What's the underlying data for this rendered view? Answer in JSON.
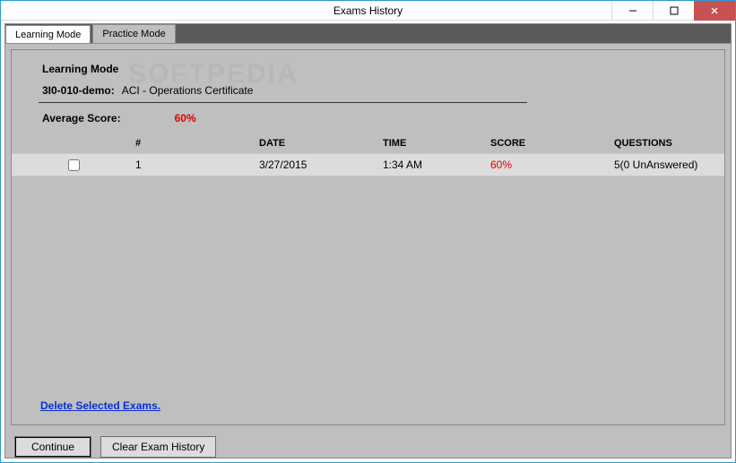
{
  "window": {
    "title": "Exams History"
  },
  "tabs": [
    {
      "label": "Learning Mode",
      "active": true
    },
    {
      "label": "Practice Mode",
      "active": false
    }
  ],
  "main": {
    "heading": "Learning Mode",
    "exam_code": "3I0-010-demo:",
    "exam_name": "ACI - Operations Certificate",
    "avg_label": "Average Score:",
    "avg_value": "60%",
    "watermark": "SOFTPEDIA"
  },
  "table": {
    "headers": {
      "num": "#",
      "date": "DATE",
      "time": "TIME",
      "score": "SCORE",
      "questions": "QUESTIONS"
    },
    "rows": [
      {
        "checked": false,
        "num": "1",
        "date": "3/27/2015",
        "time": "1:34 AM",
        "score": "60%",
        "questions": "5(0 UnAnswered)"
      }
    ]
  },
  "links": {
    "delete": "Delete Selected Exams."
  },
  "buttons": {
    "continue": "Continue",
    "clear": "Clear Exam History"
  }
}
